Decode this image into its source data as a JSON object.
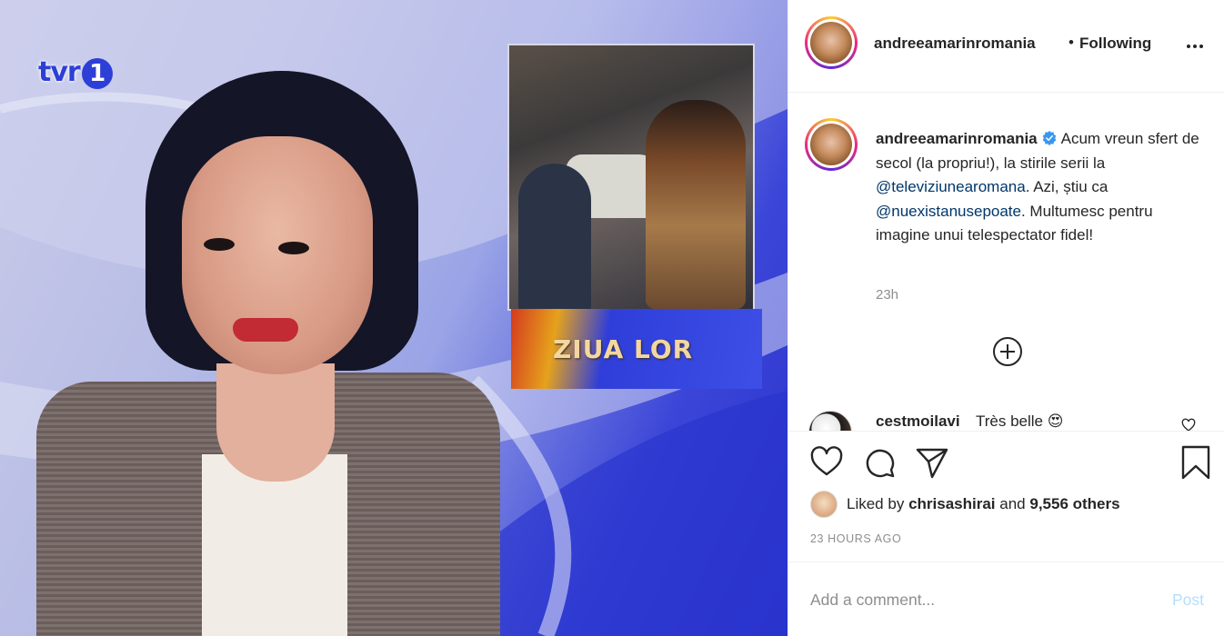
{
  "media": {
    "tv_logo_text": "tvr",
    "tv_logo_number": "1",
    "inset_caption": "ZIUA LOR"
  },
  "header": {
    "username": "andreeamarinromania",
    "separator": "•",
    "follow_state": "Following",
    "more_icon": "more-horizontal-icon"
  },
  "caption": {
    "username": "andreeamarinromania",
    "verified_icon": "verified-badge-icon",
    "text_part1": "Acum vreun sfert de secol (la propriu!), la stirile serii la ",
    "mention1": "@televiziunearomana",
    "text_part2": ". Azi, știu ca ",
    "mention2": "@nuexistanusepoate",
    "text_part3": ". Multumesc pentru imagine unui telespectator fidel!",
    "time": "23h"
  },
  "load_more_icon": "plus-circle-icon",
  "comment": {
    "username": "cestmoilavi",
    "text": "Très belle 😍"
  },
  "actions": {
    "like_icon": "heart-icon",
    "comment_icon": "comment-icon",
    "share_icon": "share-icon",
    "save_icon": "bookmark-icon"
  },
  "likes": {
    "prefix": "Liked by",
    "user": "chrisashirai",
    "middle": "and",
    "count_text": "9,556 others"
  },
  "post_time": "23 HOURS AGO",
  "comment_box": {
    "placeholder": "Add a comment...",
    "post_label": "Post",
    "post_color": "#b2dffc"
  },
  "colors": {
    "text_primary": "#262626",
    "text_secondary": "#8e8e8e",
    "mention": "#00376b",
    "verified": "#3897f0"
  }
}
